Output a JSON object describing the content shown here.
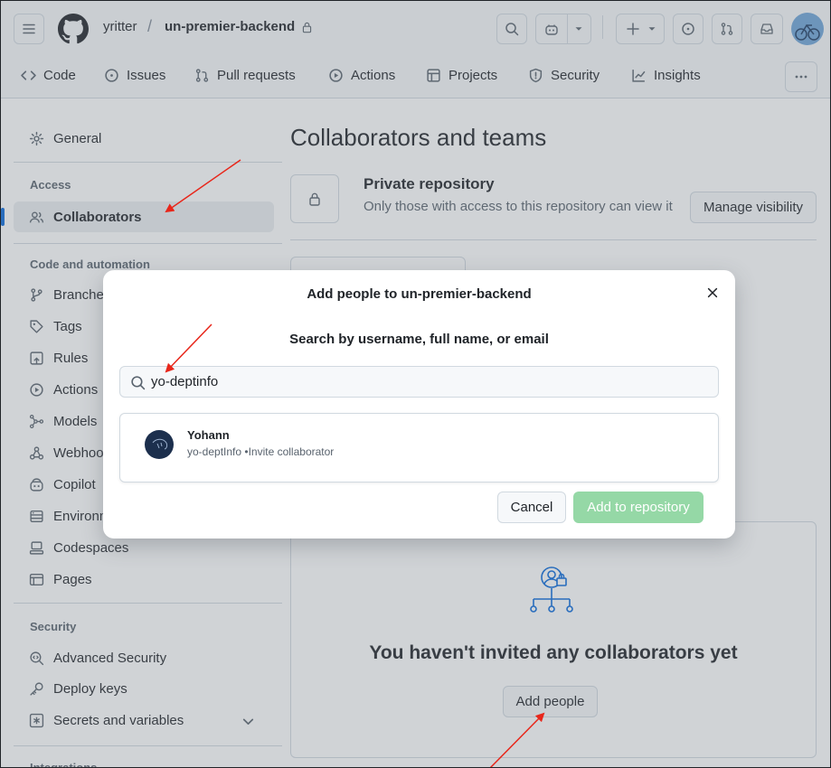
{
  "header": {
    "owner": "yritter",
    "repo": "un-premier-backend",
    "tabs": [
      {
        "label": "Code",
        "icon": "code-icon"
      },
      {
        "label": "Issues",
        "icon": "issue-icon"
      },
      {
        "label": "Pull requests",
        "icon": "pull-request-icon"
      },
      {
        "label": "Actions",
        "icon": "play-icon"
      },
      {
        "label": "Projects",
        "icon": "table-icon"
      },
      {
        "label": "Security",
        "icon": "shield-icon"
      },
      {
        "label": "Insights",
        "icon": "graph-icon"
      }
    ]
  },
  "sidebar": {
    "general": "General",
    "access_heading": "Access",
    "collaborators": "Collaborators",
    "code_heading": "Code and automation",
    "code_items": [
      "Branches",
      "Tags",
      "Rules",
      "Actions",
      "Models",
      "Webhooks",
      "Copilot",
      "Environments",
      "Codespaces",
      "Pages"
    ],
    "security_heading": "Security",
    "security_items": [
      "Advanced Security",
      "Deploy keys",
      "Secrets and variables"
    ],
    "integrations_heading": "Integrations"
  },
  "main": {
    "title": "Collaborators and teams",
    "private_title": "Private repository",
    "private_desc": "Only those with access to this repository can view it",
    "manage_visibility": "Manage visibility",
    "empty_title": "You haven't invited any collaborators yet",
    "add_people": "Add people"
  },
  "dialog": {
    "title": "Add people to un-premier-backend",
    "search_label": "Search by username, full name, or email",
    "search_value": "yo-deptinfo",
    "result_name": "Yohann",
    "result_sub": "yo-deptInfo •Invite collaborator",
    "cancel": "Cancel",
    "add": "Add to repository"
  },
  "colors": {
    "accent": "#0969da",
    "primary_disabled": "#95d8a6",
    "annotation_arrow": "#e8261a"
  }
}
